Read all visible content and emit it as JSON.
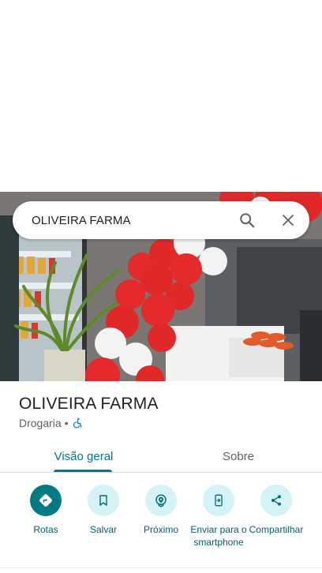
{
  "search": {
    "query": "OLIVEIRA FARMA"
  },
  "place": {
    "name": "OLIVEIRA FARMA",
    "category": "Drogaria",
    "separator": "•"
  },
  "tabs": [
    {
      "label": "Visão geral",
      "selected": true
    },
    {
      "label": "Sobre",
      "selected": false
    }
  ],
  "actions": [
    {
      "label": "Rotas",
      "icon": "directions-icon"
    },
    {
      "label": "Salvar",
      "icon": "bookmark-icon"
    },
    {
      "label": "Próximo",
      "icon": "nearby-icon"
    },
    {
      "label": "Enviar para o smartphone",
      "icon": "send-to-phone-icon"
    },
    {
      "label": "Compartilhar",
      "icon": "share-icon"
    }
  ],
  "colors": {
    "accent": "#00778a",
    "action_bg": "#d4f3f7",
    "primary_action_bg": "#007b83",
    "accessibility_icon": "#1a73e8"
  }
}
